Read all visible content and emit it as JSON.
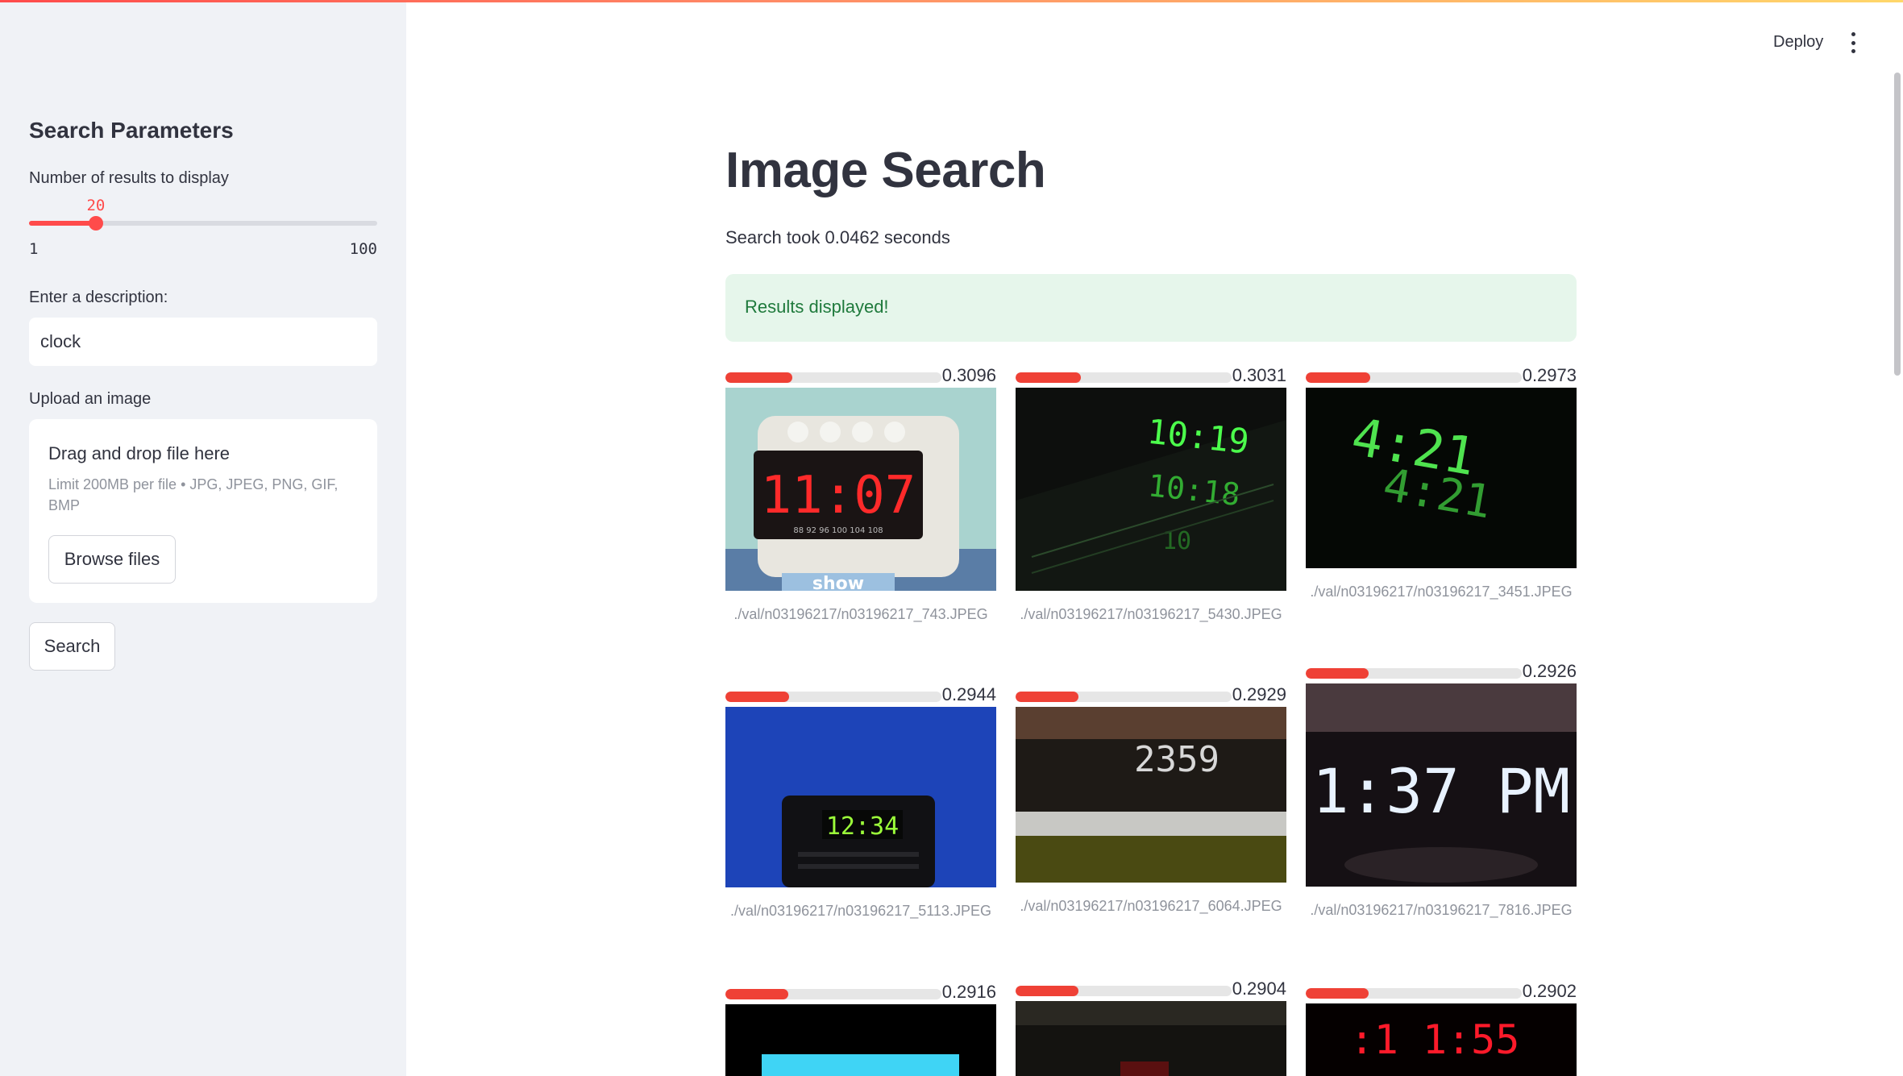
{
  "sidebar": {
    "title": "Search Parameters",
    "slider": {
      "label": "Number of results to display",
      "value": 20,
      "min": 1,
      "max": 100
    },
    "description": {
      "label": "Enter a description:",
      "value": "clock"
    },
    "uploader": {
      "label": "Upload an image",
      "title": "Drag and drop file here",
      "note": "Limit 200MB per file • JPG, JPEG, PNG, GIF, BMP",
      "browse_label": "Browse files"
    },
    "search_label": "Search"
  },
  "header": {
    "deploy_label": "Deploy",
    "menu_icon": "more-vertical-icon"
  },
  "main": {
    "title": "Image Search",
    "search_time": "Search took 0.0462 seconds",
    "alert": "Results displayed!"
  },
  "results": [
    {
      "score": "0.3096",
      "fraction": 0.3096,
      "path": "./val/n03196217/n03196217_743.JPEG",
      "image": "white alarm clock showing 11:07 in red digits"
    },
    {
      "score": "0.3031",
      "fraction": 0.3031,
      "path": "./val/n03196217/n03196217_5430.JPEG",
      "image": "green digital clock 10:19 reflected"
    },
    {
      "score": "0.2973",
      "fraction": 0.2973,
      "path": "./val/n03196217/n03196217_3451.JPEG",
      "image": "green digits 4:21 on black"
    },
    {
      "score": "0.2944",
      "fraction": 0.2944,
      "path": "./val/n03196217/n03196217_5113.JPEG",
      "image": "clock radio 12:34 on blue background"
    },
    {
      "score": "0.2929",
      "fraction": 0.2929,
      "path": "./val/n03196217/n03196217_6064.JPEG",
      "image": "display reading 2359"
    },
    {
      "score": "0.2926",
      "fraction": 0.2926,
      "path": "./val/n03196217/n03196217_7816.JPEG",
      "image": "white digits 1:37 PM"
    },
    {
      "score": "0.2916",
      "fraction": 0.2916,
      "path": "",
      "image": "cyan screen"
    },
    {
      "score": "0.2904",
      "fraction": 0.2904,
      "path": "",
      "image": "dark clock"
    },
    {
      "score": "0.2902",
      "fraction": 0.2902,
      "path": "",
      "image": "red digits 11:55 on black"
    }
  ]
}
